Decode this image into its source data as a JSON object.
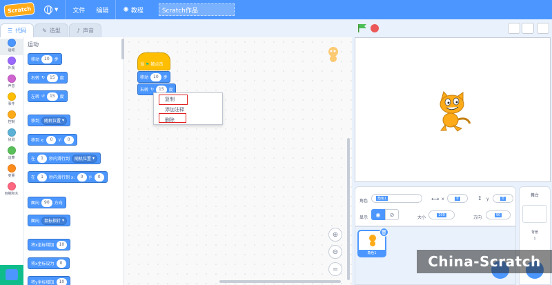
{
  "menu": {
    "logo": "Scratch",
    "file": "文件",
    "edit": "编辑",
    "tutorials": "教程",
    "project_title": "Scratch作品"
  },
  "tabs": [
    {
      "label": "代码",
      "icon": "code-icon"
    },
    {
      "label": "造型",
      "icon": "brush-icon"
    },
    {
      "label": "声音",
      "icon": "speaker-icon"
    }
  ],
  "categories": [
    {
      "label": "运动",
      "color": "#4c97ff"
    },
    {
      "label": "外观",
      "color": "#9966ff"
    },
    {
      "label": "声音",
      "color": "#cf63cf"
    },
    {
      "label": "事件",
      "color": "#ffbf00"
    },
    {
      "label": "控制",
      "color": "#ffab19"
    },
    {
      "label": "侦测",
      "color": "#5cb1d6"
    },
    {
      "label": "运算",
      "color": "#59c059"
    },
    {
      "label": "变量",
      "color": "#ff8c1a"
    },
    {
      "label": "自制积木",
      "color": "#ff6680"
    }
  ],
  "palette": {
    "heading": "运动",
    "move": {
      "a": "移动",
      "v": "10",
      "b": "步"
    },
    "turn_right": {
      "a": "右转",
      "v": "15",
      "b": "度"
    },
    "turn_left": {
      "a": "左转",
      "v": "15",
      "b": "度"
    },
    "goto": {
      "a": "移到",
      "d": "随机位置"
    },
    "goto_xy": {
      "a": "移到 x:",
      "x": "0",
      "b": "y:",
      "y": "0"
    },
    "glide": {
      "a": "在",
      "v": "1",
      "b": "秒内滑行到",
      "d": "随机位置"
    },
    "glide_xy": {
      "a": "在",
      "v": "1",
      "b": "秒内滑行到 x:",
      "x": "0",
      "c": "y:",
      "y": "0"
    },
    "point_dir": {
      "a": "面向",
      "v": "90",
      "b": "方向"
    },
    "point_toward": {
      "a": "面向",
      "d": "鼠标指针"
    },
    "change_x": {
      "a": "将x坐标增加",
      "v": "10"
    },
    "set_x": {
      "a": "将x坐标设为",
      "v": "0"
    },
    "change_y": {
      "a": "将y坐标增加",
      "v": "10"
    }
  },
  "workspace": {
    "hat": {
      "a": "当",
      "b": "被点击"
    },
    "move": {
      "a": "移动",
      "v": "10",
      "b": "步"
    },
    "turn": {
      "a": "右转",
      "v": "15",
      "b": "度"
    }
  },
  "context_menu": {
    "duplicate": "复制",
    "add_comment": "添加注释",
    "delete": "删除"
  },
  "sprite_info": {
    "sprite_label": "角色",
    "sprite_name": "角色1",
    "x_label": "x",
    "x_value": "0",
    "y_label": "y",
    "y_value": "0",
    "show_label": "显示",
    "size_label": "大小",
    "size_value": "100",
    "direction_label": "方向",
    "direction_value": "90"
  },
  "sprite_card": {
    "name": "角色1"
  },
  "stage_panel": {
    "title": "舞台",
    "backdrop_label": "背景",
    "backdrop_count": "1"
  },
  "watermark": "China-Scratch",
  "colors": {
    "accent": "#4c97ff",
    "events": "#ffbf00",
    "highlight": "#e02020"
  }
}
